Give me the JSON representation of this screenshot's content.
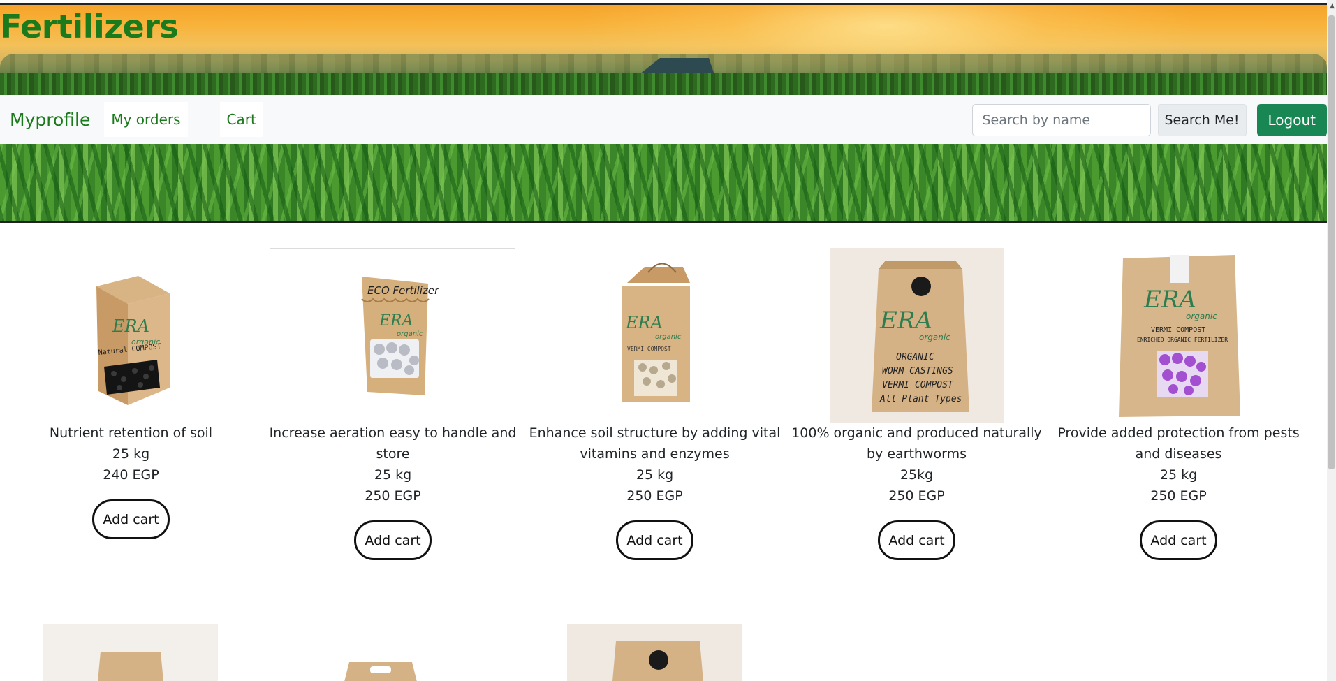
{
  "header": {
    "title": "Fertilizers"
  },
  "nav": {
    "brand": "Myprofile",
    "links": [
      {
        "label": "My orders"
      },
      {
        "label": "Cart"
      }
    ],
    "search": {
      "placeholder": "Search by name",
      "value": ""
    },
    "search_button": "Search Me!",
    "logout_button": "Logout"
  },
  "colors": {
    "brand_green": "#1b7a1b",
    "logout_green": "#198754",
    "navbar_bg": "#f8f9fa"
  },
  "products": [
    {
      "description": "Nutrient retention of soil",
      "weight": "25 kg",
      "price": "240 EGP",
      "button": "Add cart",
      "bag_text": [
        "ERA",
        "organic",
        "Natural COMPOST"
      ],
      "bead_color": "#1a1a1a"
    },
    {
      "description": "Increase aeration easy to handle and store",
      "weight": "25 kg",
      "price": "250 EGP",
      "button": "Add cart",
      "bag_text": [
        "ECO Fertilizer",
        "ERA",
        "organic"
      ],
      "bead_color": "#d9dbe0"
    },
    {
      "description": "Enhance soil structure by adding vital vitamins and enzymes",
      "weight": "25 kg",
      "price": "250 EGP",
      "button": "Add cart",
      "bag_text": [
        "ERA",
        "organic",
        "VERMI COMPOST"
      ],
      "bead_color": "#c9bfa8"
    },
    {
      "description": "100% organic and produced naturally by earthworms",
      "weight": "25kg",
      "price": "250 EGP",
      "button": "Add cart",
      "bag_text": [
        "ERA",
        "organic",
        "ORGANIC",
        "WORM CASTINGS",
        "VERMI COMPOST",
        "All Plant Types"
      ],
      "bead_color": ""
    },
    {
      "description": "Provide added protection from pests and diseases",
      "weight": "25 kg",
      "price": "250 EGP",
      "button": "Add cart",
      "bag_text": [
        "ERA",
        "organic",
        "VERMI COMPOST",
        "ENRICHED ORGANIC FERTILIZER"
      ],
      "bead_color": "#a24fd0"
    }
  ]
}
